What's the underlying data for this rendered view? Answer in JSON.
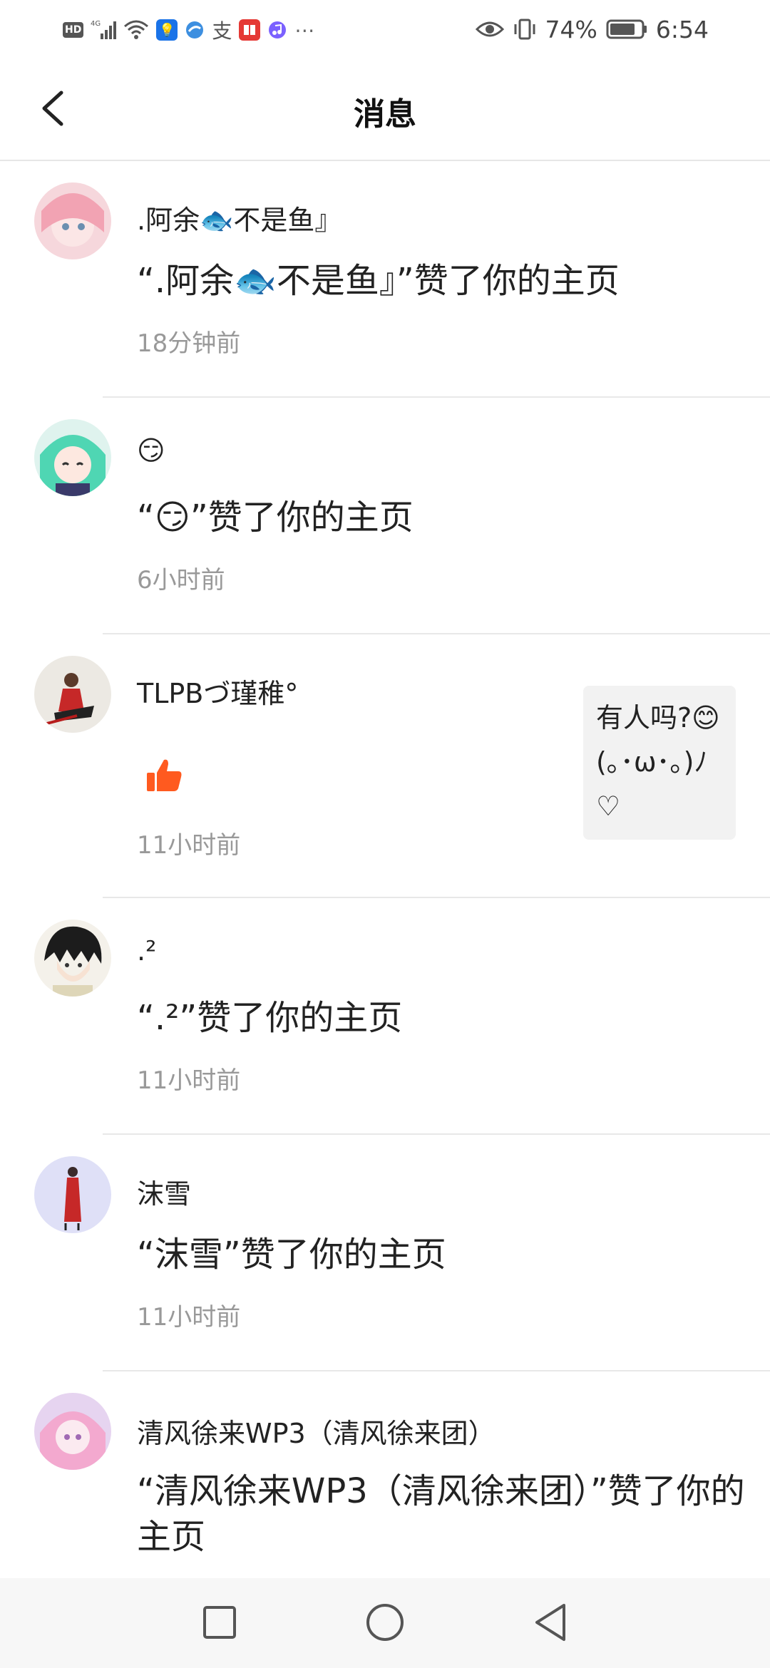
{
  "status_bar": {
    "hd": "HD",
    "network": "4G",
    "battery": "74%",
    "time": "6:54",
    "more": "⋯",
    "icons": [
      "signal-icon",
      "wifi-icon",
      "bulb-icon",
      "app-icon",
      "alipay-icon",
      "book-icon",
      "music-icon",
      "eye-icon",
      "vibrate-icon",
      "battery-icon"
    ]
  },
  "header": {
    "title": "消息"
  },
  "messages": [
    {
      "name": ".阿余🐟不是鱼』",
      "text": "“.阿余🐟不是鱼』”赞了你的主页",
      "time": "18分钟前"
    },
    {
      "name": "😏",
      "text": "“😏”赞了你的主页",
      "time": "6小时前"
    },
    {
      "name": "TLPBづ瑾稚°",
      "like_icon": "thumbs-up-icon",
      "quote": "有人吗?😊(｡･ω･｡)ﾉ♡",
      "time": "11小时前"
    },
    {
      "name": ".²",
      "text": "“.²”赞了你的主页",
      "time": "11小时前"
    },
    {
      "name": "沫雪",
      "text": "“沫雪”赞了你的主页",
      "time": "11小时前"
    },
    {
      "name": "清风徐来WP3（清风徐来团）",
      "text": "“清风徐来WP3（清风徐来团）”赞了你的主页",
      "time": ""
    }
  ],
  "colors": {
    "like": "#ff5a1f",
    "divider": "#e8e8e8",
    "time": "#999999"
  }
}
